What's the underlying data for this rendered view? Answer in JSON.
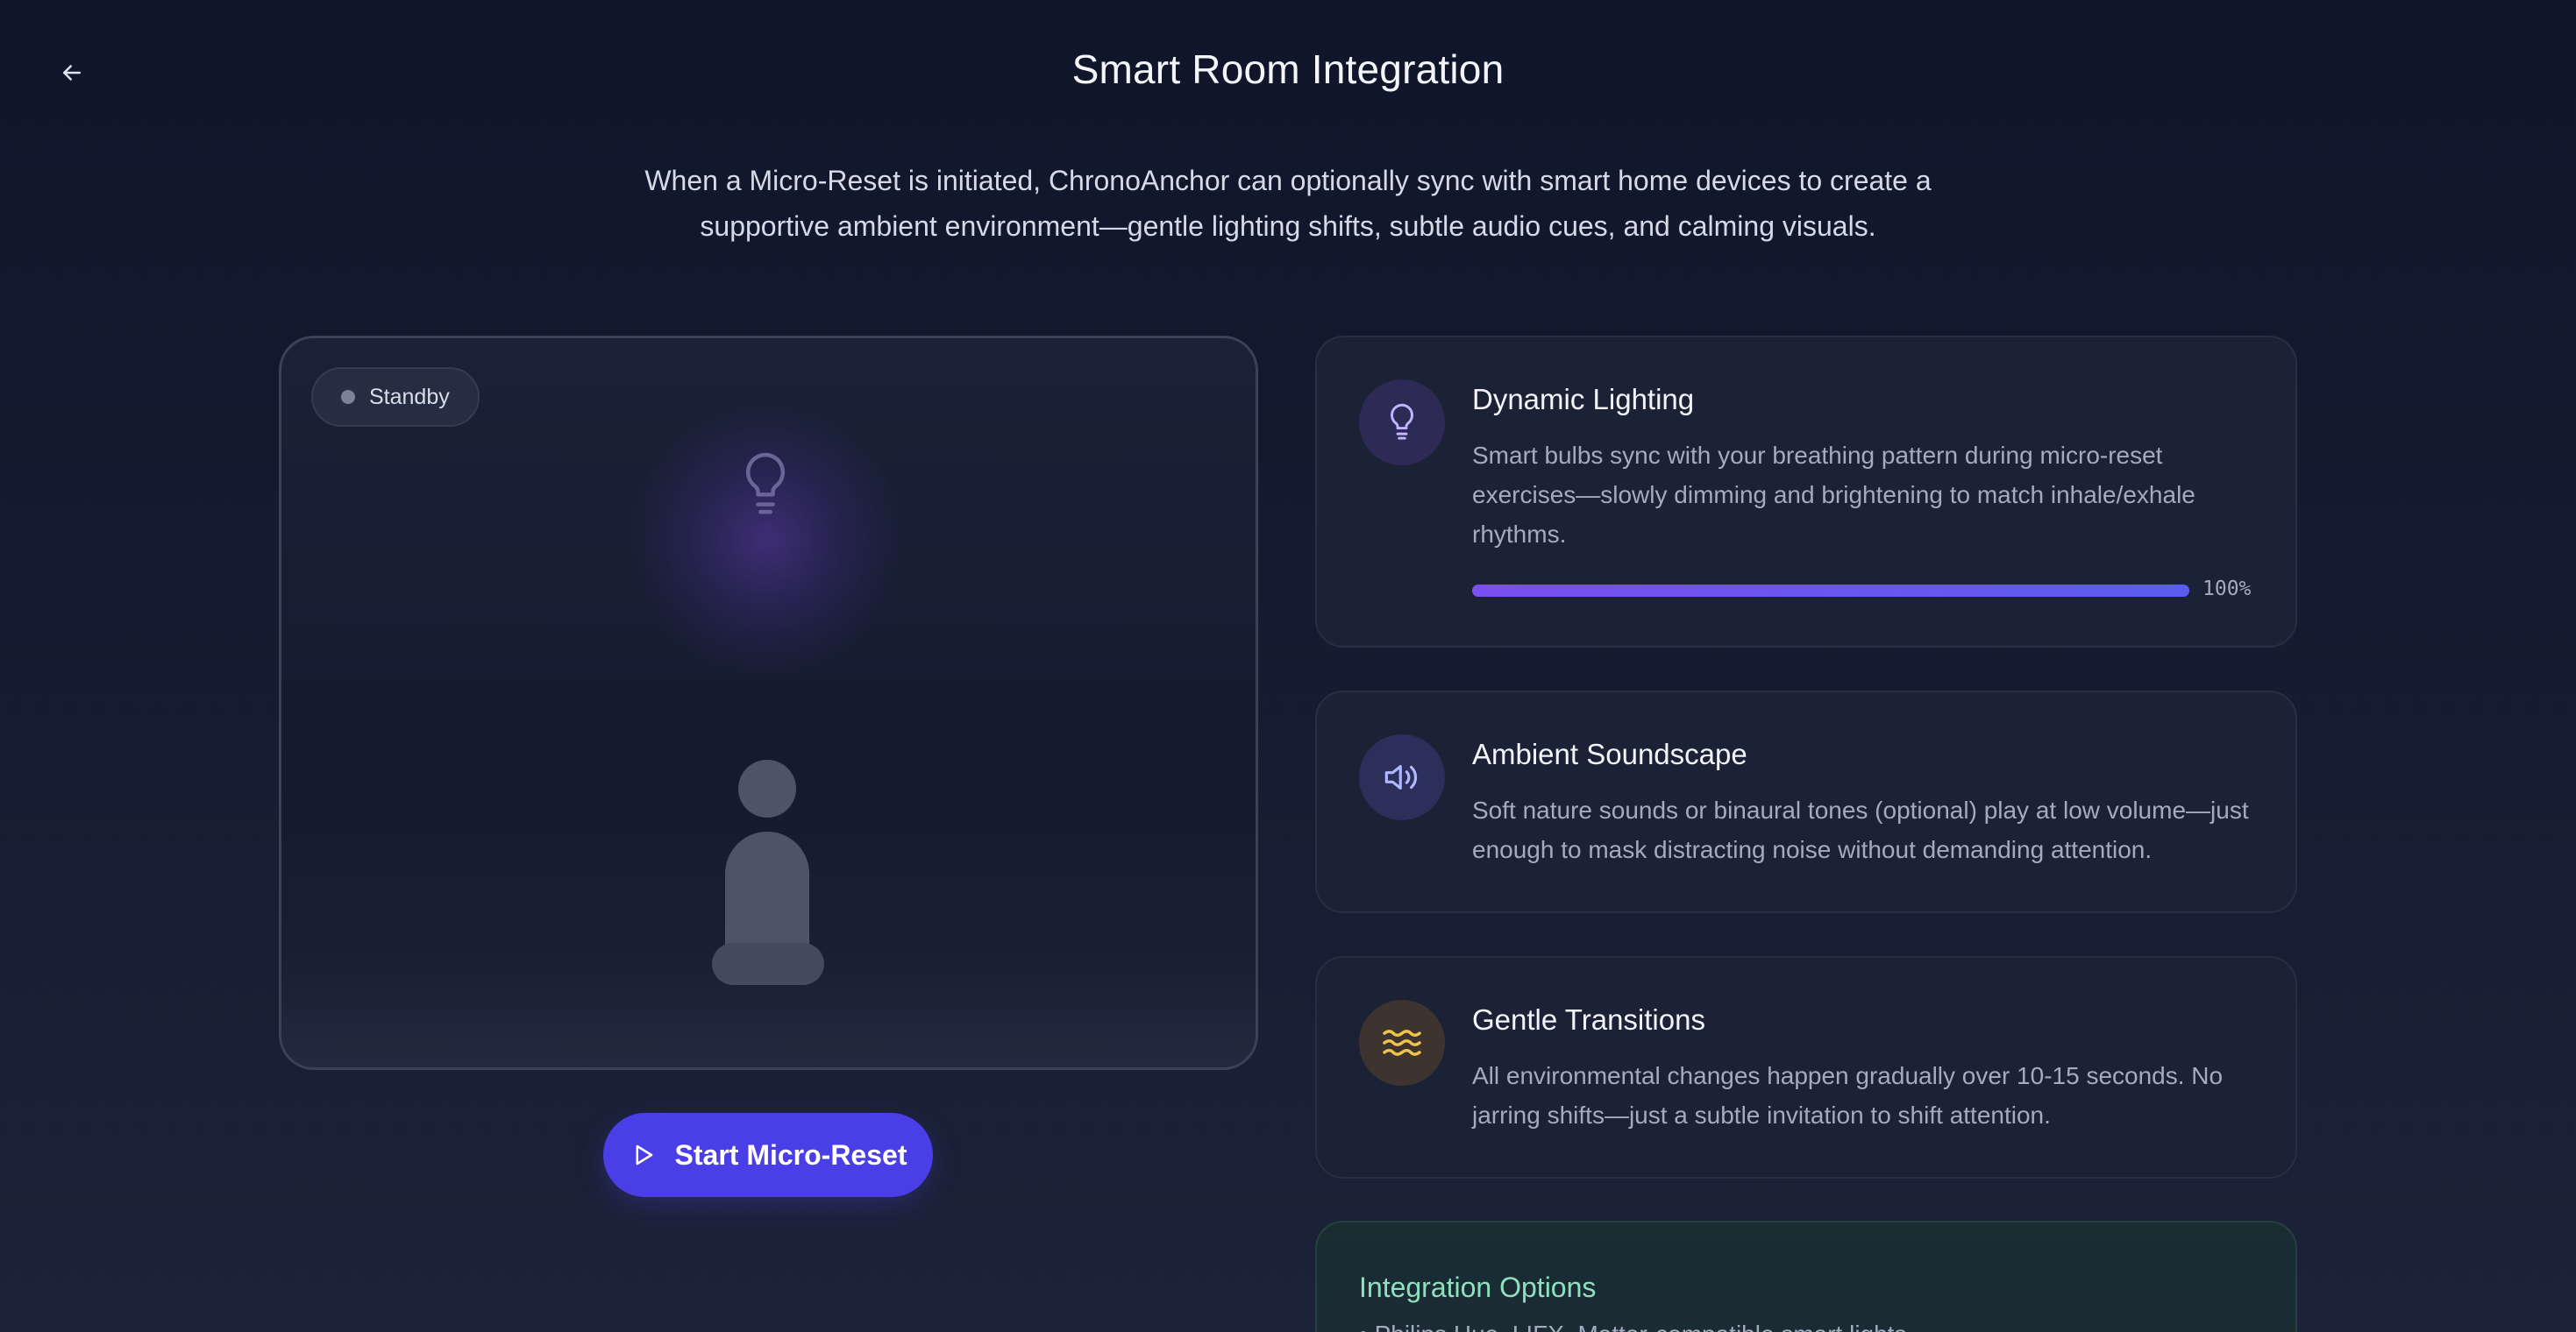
{
  "header": {
    "title": "Smart Room Integration",
    "back_icon": "arrow-left-icon"
  },
  "intro": "When a Micro-Reset is initiated, ChronoAnchor can optionally sync with smart home devices to create a supportive ambient environment—gentle lighting shifts, subtle audio cues, and calming visuals.",
  "room": {
    "status": "Standby",
    "status_color": "#7a8296",
    "light_icon": "lightbulb-icon",
    "figure": "meditating-person-figure"
  },
  "start_button": {
    "label": "Start Micro-Reset",
    "icon": "play-icon",
    "color": "#4a3ee6"
  },
  "features": [
    {
      "title": "Dynamic Lighting",
      "description": "Smart bulbs sync with your breathing pattern during micro-reset exercises—slowly dimming and brightening to match inhale/exhale rhythms.",
      "icon": "lightbulb-icon",
      "icon_bg": "#2d2a55",
      "icon_color": "#b9a6ff",
      "progress": 1.0,
      "progress_label": "100%"
    },
    {
      "title": "Ambient Soundscape",
      "description": "Soft nature sounds or binaural tones (optional) play at low volume—just enough to mask distracting noise without demanding attention.",
      "icon": "speaker-icon",
      "icon_bg": "#2b2f5a",
      "icon_color": "#a9b2ff"
    },
    {
      "title": "Gentle Transitions",
      "description": "All environmental changes happen gradually over 10-15 seconds. No jarring shifts—just a subtle invitation to shift attention.",
      "icon": "waves-icon",
      "icon_bg": "#3d3430",
      "icon_color": "#f2c34a"
    }
  ],
  "integration": {
    "title": "Integration Options",
    "line": "• Philips Hue, LIFX, Matter-compatible smart lights"
  }
}
